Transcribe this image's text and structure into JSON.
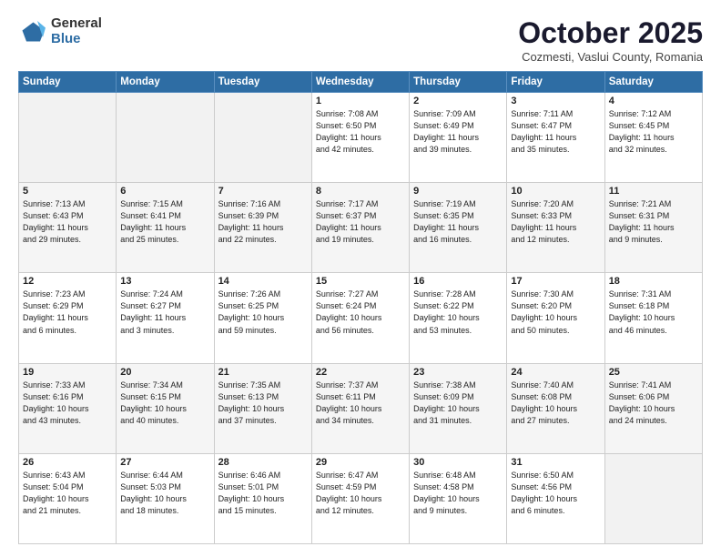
{
  "header": {
    "logo_general": "General",
    "logo_blue": "Blue",
    "month_title": "October 2025",
    "location": "Cozmesti, Vaslui County, Romania"
  },
  "weekdays": [
    "Sunday",
    "Monday",
    "Tuesday",
    "Wednesday",
    "Thursday",
    "Friday",
    "Saturday"
  ],
  "weeks": [
    [
      {
        "day": "",
        "info": ""
      },
      {
        "day": "",
        "info": ""
      },
      {
        "day": "",
        "info": ""
      },
      {
        "day": "1",
        "info": "Sunrise: 7:08 AM\nSunset: 6:50 PM\nDaylight: 11 hours\nand 42 minutes."
      },
      {
        "day": "2",
        "info": "Sunrise: 7:09 AM\nSunset: 6:49 PM\nDaylight: 11 hours\nand 39 minutes."
      },
      {
        "day": "3",
        "info": "Sunrise: 7:11 AM\nSunset: 6:47 PM\nDaylight: 11 hours\nand 35 minutes."
      },
      {
        "day": "4",
        "info": "Sunrise: 7:12 AM\nSunset: 6:45 PM\nDaylight: 11 hours\nand 32 minutes."
      }
    ],
    [
      {
        "day": "5",
        "info": "Sunrise: 7:13 AM\nSunset: 6:43 PM\nDaylight: 11 hours\nand 29 minutes."
      },
      {
        "day": "6",
        "info": "Sunrise: 7:15 AM\nSunset: 6:41 PM\nDaylight: 11 hours\nand 25 minutes."
      },
      {
        "day": "7",
        "info": "Sunrise: 7:16 AM\nSunset: 6:39 PM\nDaylight: 11 hours\nand 22 minutes."
      },
      {
        "day": "8",
        "info": "Sunrise: 7:17 AM\nSunset: 6:37 PM\nDaylight: 11 hours\nand 19 minutes."
      },
      {
        "day": "9",
        "info": "Sunrise: 7:19 AM\nSunset: 6:35 PM\nDaylight: 11 hours\nand 16 minutes."
      },
      {
        "day": "10",
        "info": "Sunrise: 7:20 AM\nSunset: 6:33 PM\nDaylight: 11 hours\nand 12 minutes."
      },
      {
        "day": "11",
        "info": "Sunrise: 7:21 AM\nSunset: 6:31 PM\nDaylight: 11 hours\nand 9 minutes."
      }
    ],
    [
      {
        "day": "12",
        "info": "Sunrise: 7:23 AM\nSunset: 6:29 PM\nDaylight: 11 hours\nand 6 minutes."
      },
      {
        "day": "13",
        "info": "Sunrise: 7:24 AM\nSunset: 6:27 PM\nDaylight: 11 hours\nand 3 minutes."
      },
      {
        "day": "14",
        "info": "Sunrise: 7:26 AM\nSunset: 6:25 PM\nDaylight: 10 hours\nand 59 minutes."
      },
      {
        "day": "15",
        "info": "Sunrise: 7:27 AM\nSunset: 6:24 PM\nDaylight: 10 hours\nand 56 minutes."
      },
      {
        "day": "16",
        "info": "Sunrise: 7:28 AM\nSunset: 6:22 PM\nDaylight: 10 hours\nand 53 minutes."
      },
      {
        "day": "17",
        "info": "Sunrise: 7:30 AM\nSunset: 6:20 PM\nDaylight: 10 hours\nand 50 minutes."
      },
      {
        "day": "18",
        "info": "Sunrise: 7:31 AM\nSunset: 6:18 PM\nDaylight: 10 hours\nand 46 minutes."
      }
    ],
    [
      {
        "day": "19",
        "info": "Sunrise: 7:33 AM\nSunset: 6:16 PM\nDaylight: 10 hours\nand 43 minutes."
      },
      {
        "day": "20",
        "info": "Sunrise: 7:34 AM\nSunset: 6:15 PM\nDaylight: 10 hours\nand 40 minutes."
      },
      {
        "day": "21",
        "info": "Sunrise: 7:35 AM\nSunset: 6:13 PM\nDaylight: 10 hours\nand 37 minutes."
      },
      {
        "day": "22",
        "info": "Sunrise: 7:37 AM\nSunset: 6:11 PM\nDaylight: 10 hours\nand 34 minutes."
      },
      {
        "day": "23",
        "info": "Sunrise: 7:38 AM\nSunset: 6:09 PM\nDaylight: 10 hours\nand 31 minutes."
      },
      {
        "day": "24",
        "info": "Sunrise: 7:40 AM\nSunset: 6:08 PM\nDaylight: 10 hours\nand 27 minutes."
      },
      {
        "day": "25",
        "info": "Sunrise: 7:41 AM\nSunset: 6:06 PM\nDaylight: 10 hours\nand 24 minutes."
      }
    ],
    [
      {
        "day": "26",
        "info": "Sunrise: 6:43 AM\nSunset: 5:04 PM\nDaylight: 10 hours\nand 21 minutes."
      },
      {
        "day": "27",
        "info": "Sunrise: 6:44 AM\nSunset: 5:03 PM\nDaylight: 10 hours\nand 18 minutes."
      },
      {
        "day": "28",
        "info": "Sunrise: 6:46 AM\nSunset: 5:01 PM\nDaylight: 10 hours\nand 15 minutes."
      },
      {
        "day": "29",
        "info": "Sunrise: 6:47 AM\nSunset: 4:59 PM\nDaylight: 10 hours\nand 12 minutes."
      },
      {
        "day": "30",
        "info": "Sunrise: 6:48 AM\nSunset: 4:58 PM\nDaylight: 10 hours\nand 9 minutes."
      },
      {
        "day": "31",
        "info": "Sunrise: 6:50 AM\nSunset: 4:56 PM\nDaylight: 10 hours\nand 6 minutes."
      },
      {
        "day": "",
        "info": ""
      }
    ]
  ]
}
